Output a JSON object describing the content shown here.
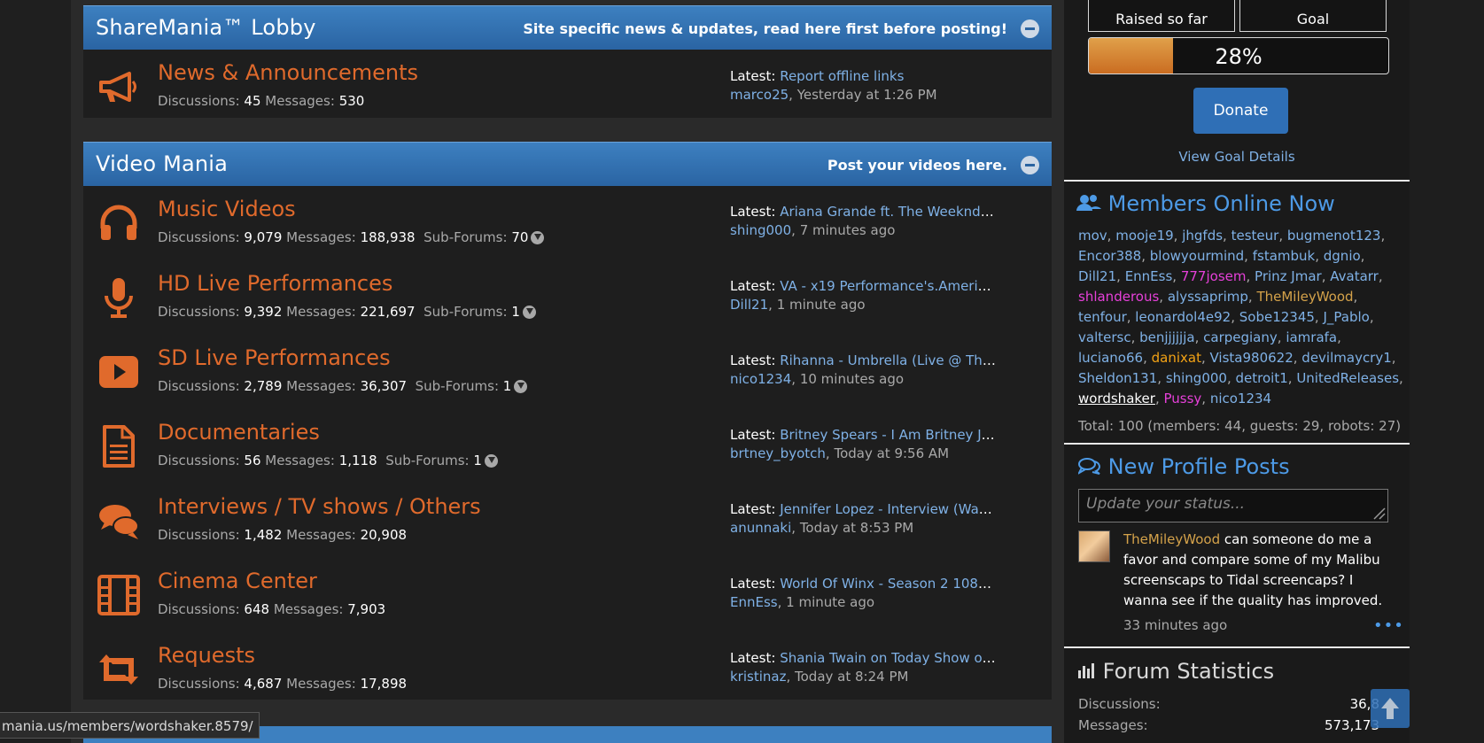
{
  "lobby": {
    "title": "ShareMania™ Lobby",
    "description": "Site specific news & updates, read here first before posting!",
    "forums": [
      {
        "icon": "megaphone-icon",
        "title": "News & Announcements",
        "discussions": "45",
        "messages": "530",
        "latest_title": "Report offline links",
        "latest_user": "marco25",
        "latest_time": "Yesterday at 1:26 PM"
      }
    ]
  },
  "video": {
    "title": "Video Mania",
    "description": "Post your videos here.",
    "forums": [
      {
        "icon": "headphones-icon",
        "title": "Music Videos",
        "discussions": "9,079",
        "messages": "188,938",
        "subforums": "70",
        "latest_title": "Ariana Grande ft. The Weeknd - ...",
        "latest_user": "shing000",
        "latest_time": "7 minutes ago"
      },
      {
        "icon": "microphone-icon",
        "title": "HD Live Performances",
        "discussions": "9,392",
        "messages": "221,697",
        "subforums": "1",
        "latest_title": "VA - x19 Performance's.American...",
        "latest_user": "Dill21",
        "latest_time": "1 minute ago"
      },
      {
        "icon": "play-icon",
        "title": "SD Live Performances",
        "discussions": "2,789",
        "messages": "36,307",
        "subforums": "1",
        "latest_title": "Rihanna - Umbrella (Live @ The ...",
        "latest_user": "nico1234",
        "latest_time": "10 minutes ago"
      },
      {
        "icon": "document-icon",
        "title": "Documentaries",
        "discussions": "56",
        "messages": "1,118",
        "subforums": "1",
        "latest_title": "Britney Spears - I Am Britney Jea...",
        "latest_user": "brtney_byotch",
        "latest_time": "Today at 9:56 AM"
      },
      {
        "icon": "chat-bubbles-icon",
        "title": "Interviews / TV shows / Others",
        "discussions": "1,482",
        "messages": "20,908",
        "latest_title": "Jennifer Lopez - Interview (Watc...",
        "latest_user": "anunnaki",
        "latest_time": "Today at 8:53 PM"
      },
      {
        "icon": "film-icon",
        "title": "Cinema Center",
        "discussions": "648",
        "messages": "7,903",
        "latest_title": "World Of Winx - Season 2 1080p ...",
        "latest_user": "EnnEss",
        "latest_time": "1 minute ago"
      },
      {
        "icon": "retweet-icon",
        "title": "Requests",
        "discussions": "4,687",
        "messages": "17,898",
        "latest_title": "Shania Twain on Today Show on J...",
        "latest_user": "kristinaz",
        "latest_time": "Today at 8:24 PM"
      }
    ]
  },
  "labels": {
    "discussions": "Discussions:",
    "messages": "Messages:",
    "subforums": "Sub-Forums:",
    "latest": "Latest:"
  },
  "donation": {
    "raised_label": "Raised so far",
    "goal_label": "Goal",
    "percent": 28,
    "percent_label": "28%",
    "donate_label": "Donate",
    "goal_details": "View Goal Details"
  },
  "members_online": {
    "title": "Members Online Now",
    "members": [
      {
        "name": "mov"
      },
      {
        "name": "mooje19"
      },
      {
        "name": "jhgfds"
      },
      {
        "name": "testeur"
      },
      {
        "name": "bugmenot123"
      },
      {
        "name": "Encor388"
      },
      {
        "name": "blowyourmind"
      },
      {
        "name": "fstambuk"
      },
      {
        "name": "dgnio"
      },
      {
        "name": "Dill21"
      },
      {
        "name": "EnnEss"
      },
      {
        "name": "777josem",
        "style": "pink"
      },
      {
        "name": "Prinz Jmar"
      },
      {
        "name": "Avatarr"
      },
      {
        "name": "shlanderous",
        "style": "pink"
      },
      {
        "name": "alyssaprimp"
      },
      {
        "name": "TheMileyWood",
        "style": "gold"
      },
      {
        "name": "tenfour"
      },
      {
        "name": "leonardol4e92"
      },
      {
        "name": "Sobe12345"
      },
      {
        "name": "J_Pablo"
      },
      {
        "name": "valtersc"
      },
      {
        "name": "benjjjjjja"
      },
      {
        "name": "carpegiany"
      },
      {
        "name": "iamrafa"
      },
      {
        "name": "luciano66"
      },
      {
        "name": "danixat",
        "style": "orange"
      },
      {
        "name": "Vista980622"
      },
      {
        "name": "devilmaycry1"
      },
      {
        "name": "Sheldon131"
      },
      {
        "name": "shing000"
      },
      {
        "name": "detroit1"
      },
      {
        "name": "UnitedReleases"
      },
      {
        "name": "wordshaker",
        "style": "ul"
      },
      {
        "name": "Pussy",
        "style": "pink"
      },
      {
        "name": "nico1234"
      }
    ],
    "total": "Total: 100 (members: 44, guests: 29, robots: 27)"
  },
  "profile_posts": {
    "title": "New Profile Posts",
    "placeholder": "Update your status...",
    "post_user": "TheMileyWood",
    "post_text": " can someone do me a favor and compare some of my Malibu screenscaps to Tidal screencaps? I wanna see if the quality has improved.",
    "post_time": "33 minutes ago",
    "more": "•••"
  },
  "stats": {
    "title": "Forum Statistics",
    "discussions_label": "Discussions:",
    "discussions_value": "36,8",
    "messages_label": "Messages:",
    "messages_value": "573,173"
  },
  "statusbar": {
    "url": "mania.us/members/wordshaker.8579/"
  },
  "colors": {
    "accent": "#2f6fb6",
    "forum_title": "#e06a2c",
    "link": "#7fb1e6"
  }
}
